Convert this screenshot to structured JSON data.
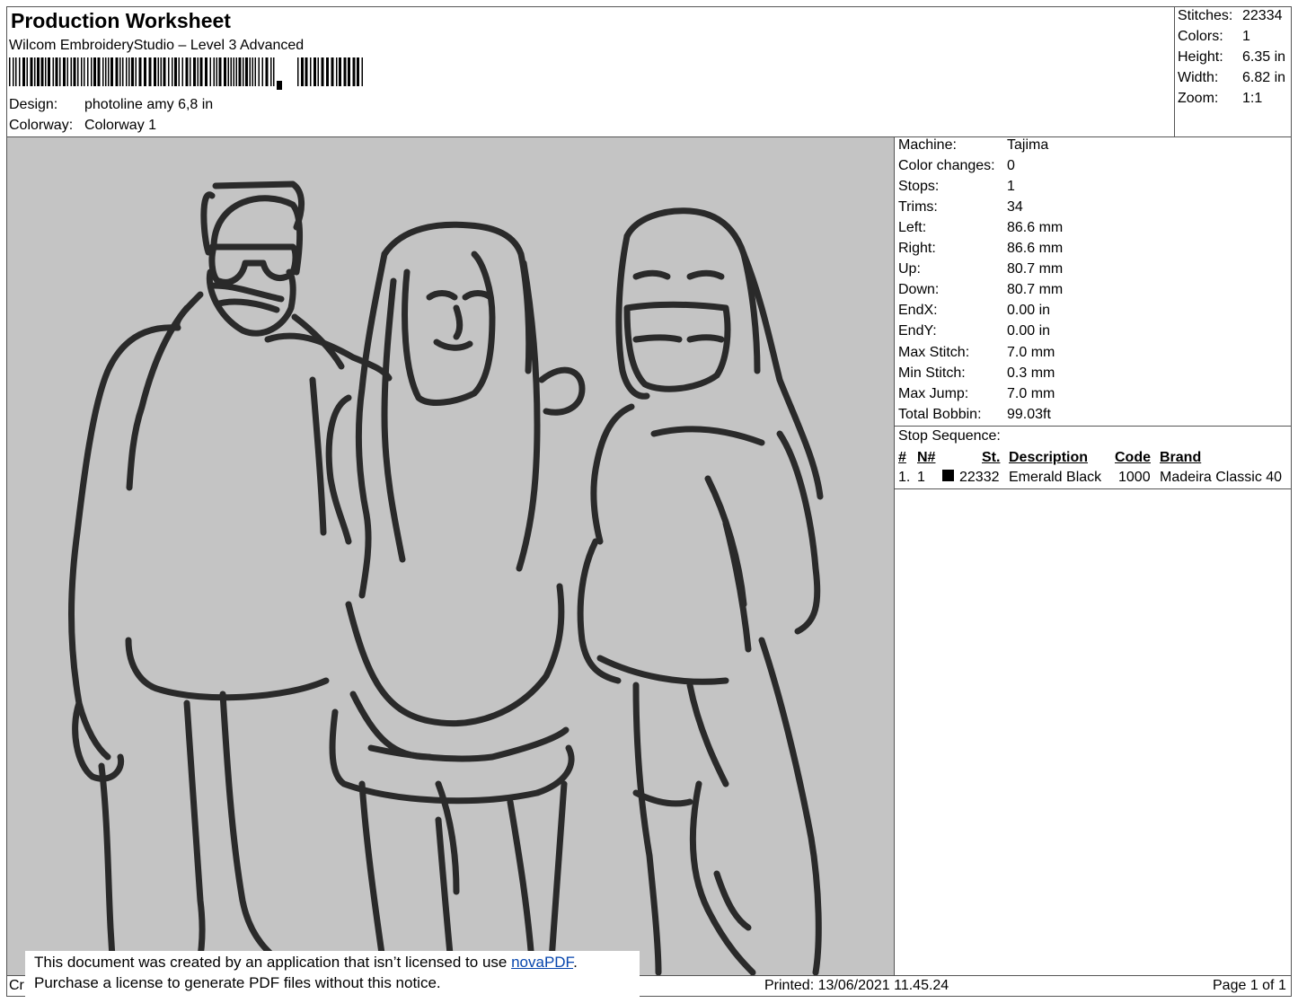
{
  "header": {
    "title": "Production Worksheet",
    "software": "Wilcom EmbroideryStudio – Level 3 Advanced",
    "design_label": "Design:",
    "design_value": "photoline amy 6,8 in",
    "colorway_label": "Colorway:",
    "colorway_value": "Colorway 1"
  },
  "summary": [
    {
      "label": "Stitches:",
      "value": "22334"
    },
    {
      "label": "Colors:",
      "value": "1"
    },
    {
      "label": "Height:",
      "value": "6.35 in"
    },
    {
      "label": "Width:",
      "value": "6.82 in"
    },
    {
      "label": "Zoom:",
      "value": "1:1"
    }
  ],
  "machine_info": [
    {
      "label": "Machine:",
      "value": "Tajima"
    },
    {
      "label": "Color changes:",
      "value": "0"
    },
    {
      "label": "Stops:",
      "value": "1"
    },
    {
      "label": "Trims:",
      "value": "34"
    },
    {
      "label": "Left:",
      "value": "86.6 mm"
    },
    {
      "label": "Right:",
      "value": "86.6 mm"
    },
    {
      "label": "Up:",
      "value": "80.7 mm"
    },
    {
      "label": "Down:",
      "value": "80.7 mm"
    },
    {
      "label": "EndX:",
      "value": "0.00 in"
    },
    {
      "label": "EndY:",
      "value": "0.00 in"
    },
    {
      "label": "Max Stitch:",
      "value": "7.0 mm"
    },
    {
      "label": "Min Stitch:",
      "value": "0.3 mm"
    },
    {
      "label": "Max Jump:",
      "value": "7.0 mm"
    },
    {
      "label": "Total Bobbin:",
      "value": "99.03ft"
    }
  ],
  "stop_sequence": {
    "title": "Stop Sequence:",
    "headers": [
      "#",
      "N#",
      "St.",
      "Description",
      "Code",
      "Brand"
    ],
    "rows": [
      {
        "index": "1.",
        "n": "1",
        "swatch_color": "#000000",
        "stitches": "22332",
        "description": "Emerald Black",
        "code": "1000",
        "brand": "Madeira Classic 40"
      }
    ]
  },
  "footer": {
    "left_fragment": "Cr",
    "printed": "Printed: 13/06/2021 11.45.24",
    "page": "Page 1 of 1"
  },
  "notice": {
    "line1_prefix": "This document was created by an application that isn’t licensed to use ",
    "link_text": "novaPDF",
    "line1_suffix": ".",
    "line2": "Purchase a license to generate PDF files without this notice."
  },
  "colors": {
    "design_background": "#c4c4c4",
    "stitch": "#2a2a2a",
    "link": "#0645ad"
  }
}
